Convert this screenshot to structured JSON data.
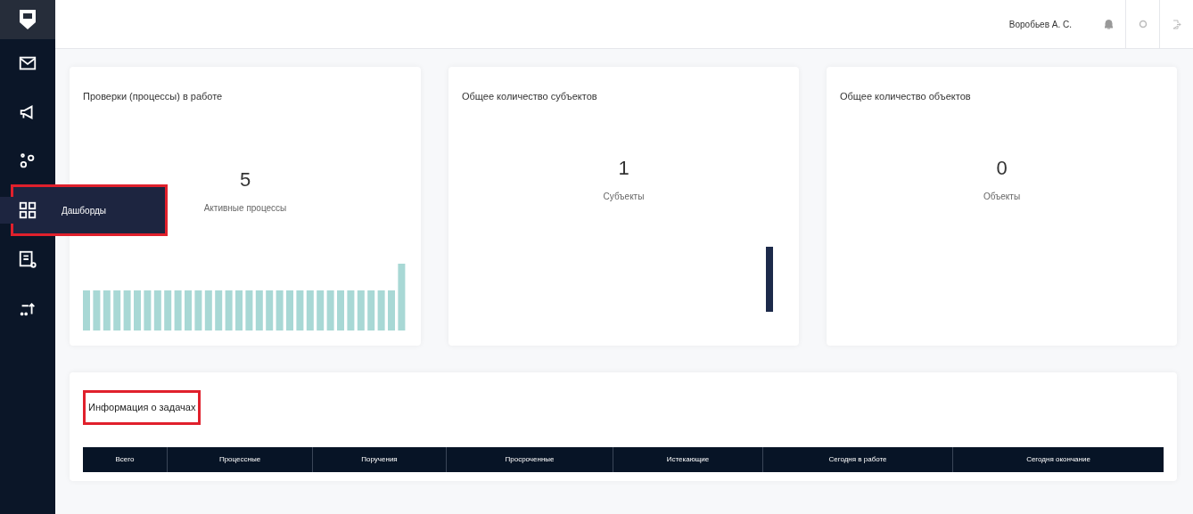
{
  "sidebar": {
    "items": [
      {
        "selected": false
      },
      {
        "selected": false
      },
      {
        "selected": false
      },
      {
        "selected": true,
        "tooltip": "Дашборды",
        "highlighted": true
      },
      {
        "selected": false
      },
      {
        "selected": false
      }
    ]
  },
  "header": {
    "user": "Воробьев А. С."
  },
  "cards": [
    {
      "title": "Проверки (процессы) в работе",
      "value": "5",
      "caption": "Активные процессы",
      "kind": "bars"
    },
    {
      "title": "Общее количество субъектов",
      "value": "1",
      "caption": "Субъекты",
      "kind": "single"
    },
    {
      "title": "Общее количество объектов",
      "value": "0",
      "caption": "Объекты",
      "kind": "empty"
    }
  ],
  "tasks": {
    "title": "Информация о задачах",
    "highlighted": true,
    "columns": [
      "Всего",
      "Процессные",
      "Поручения",
      "Просроченные",
      "Истекающие",
      "Сегодня в работе",
      "Сегодня окончание"
    ]
  }
}
